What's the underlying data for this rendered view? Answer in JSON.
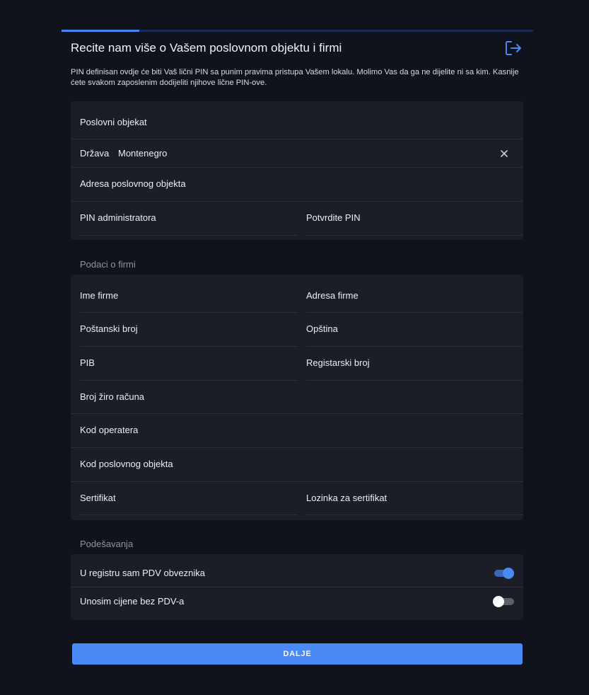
{
  "header": {
    "title": "Recite nam više o Vašem poslovnom objektu i firmi",
    "description": "PIN definisan ovdje će biti Vaš lični PIN sa punim pravima pristupa Vašem lokalu. Molimo Vas da ga ne dijelite ni sa kim. Kasnije ćete svakom zaposlenim dodijeliti njihove lične PIN-ove.",
    "progress": 0.165,
    "logout_icon": "logout-icon"
  },
  "business": {
    "name_label": "Poslovni objekat",
    "country_label": "Država",
    "country_value": "Montenegro",
    "address_label": "Adresa poslovnog objekta",
    "pin_label": "PIN administratora",
    "pin_confirm_label": "Potvrdite PIN"
  },
  "company": {
    "section_title": "Podaci o firmi",
    "name_label": "Ime firme",
    "address_label": "Adresa firme",
    "postal_label": "Poštanski broj",
    "municipality_label": "Opština",
    "pib_label": "PIB",
    "registry_label": "Registarski broj",
    "account_label": "Broj žiro računa",
    "operator_label": "Kod operatera",
    "unit_code_label": "Kod poslovnog objekta",
    "certificate_label": "Sertifikat",
    "certificate_password_label": "Lozinka za sertifikat"
  },
  "settings": {
    "section_title": "Podešavanja",
    "vat_label": "U registru sam PDV obveznika",
    "vat_enabled": true,
    "prices_label": "Unosim cijene bez PDV-a",
    "prices_enabled": false
  },
  "footer": {
    "next_label": "DALJE"
  },
  "colors": {
    "accent": "#4a8af7",
    "card": "#1b1e27",
    "background": "#10131b"
  }
}
